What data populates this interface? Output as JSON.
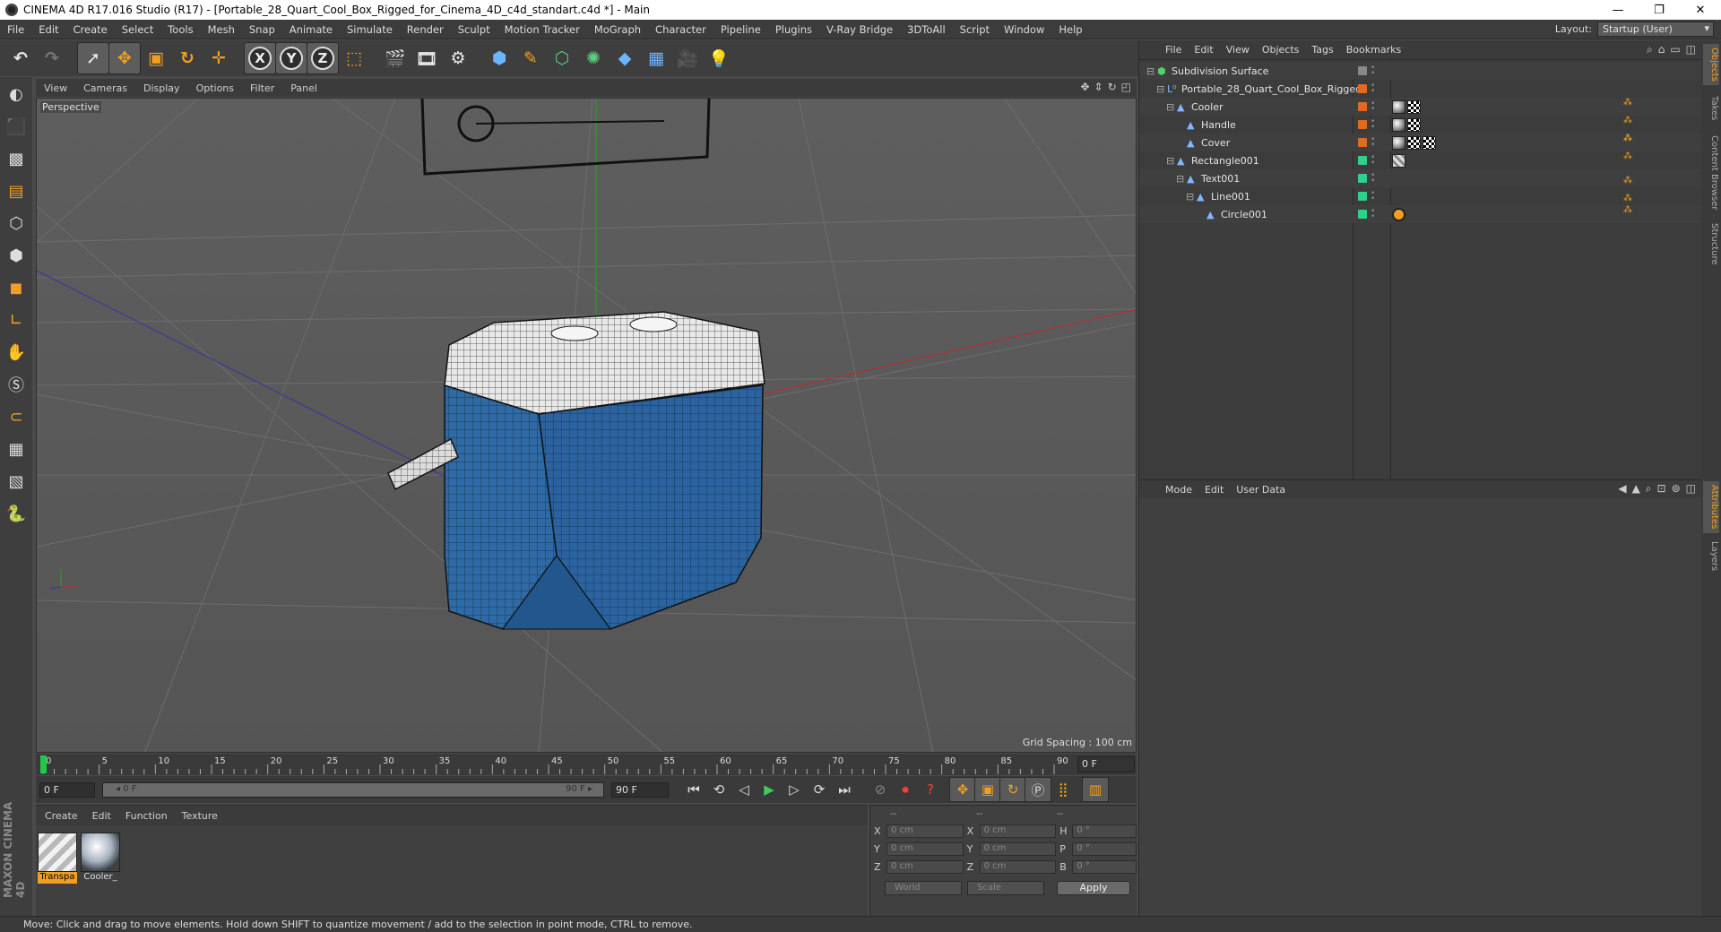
{
  "window": {
    "title": "CINEMA 4D R17.016 Studio (R17) - [Portable_28_Quart_Cool_Box_Rigged_for_Cinema_4D_c4d_standart.c4d *] - Main",
    "minimize": "—",
    "maximize": "❐",
    "close": "✕"
  },
  "menubar": {
    "items": [
      "File",
      "Edit",
      "Create",
      "Select",
      "Tools",
      "Mesh",
      "Snap",
      "Animate",
      "Simulate",
      "Render",
      "Sculpt",
      "Motion Tracker",
      "MoGraph",
      "Character",
      "Pipeline",
      "Plugins",
      "V-Ray Bridge",
      "3DToAll",
      "Script",
      "Window",
      "Help"
    ],
    "layout_label": "Layout:",
    "layout_value": "Startup (User)"
  },
  "toolbar": {
    "x_label": "X",
    "y_label": "Y",
    "z_label": "Z"
  },
  "viewport": {
    "menu": [
      "View",
      "Cameras",
      "Display",
      "Options",
      "Filter",
      "Panel"
    ],
    "label": "Perspective",
    "grid_spacing": "Grid Spacing : 100 cm"
  },
  "timeline": {
    "ticks": [
      "0",
      "5",
      "10",
      "15",
      "20",
      "25",
      "30",
      "35",
      "40",
      "45",
      "50",
      "55",
      "60",
      "65",
      "70",
      "75",
      "80",
      "85",
      "90"
    ],
    "end_field": "0 F",
    "current_frame": "0 F",
    "range_start": "◂ 0 F",
    "range_end": "90 F ▸",
    "max_frame": "90 F"
  },
  "material_manager": {
    "menu": [
      "Create",
      "Edit",
      "Function",
      "Texture"
    ],
    "materials": [
      {
        "name": "Transpa",
        "selected": true
      },
      {
        "name": "Cooler_",
        "selected": false
      }
    ]
  },
  "coordinates": {
    "headers": [
      "--",
      "--",
      "--"
    ],
    "rows": [
      {
        "a": "X",
        "v1": "0 cm",
        "b": "X",
        "v2": "0 cm",
        "c": "H",
        "v3": "0 °"
      },
      {
        "a": "Y",
        "v1": "0 cm",
        "b": "Y",
        "v2": "0 cm",
        "c": "P",
        "v3": "0 °"
      },
      {
        "a": "Z",
        "v1": "0 cm",
        "b": "Z",
        "v2": "0 cm",
        "c": "B",
        "v3": "0 °"
      }
    ],
    "mode_world": "World",
    "mode_scale": "Scale",
    "apply": "Apply"
  },
  "object_manager": {
    "menu": [
      "File",
      "Edit",
      "View",
      "Objects",
      "Tags",
      "Bookmarks"
    ],
    "objects": [
      {
        "name": "Subdivision Surface",
        "indent": 0,
        "icon": "subdivision-icon",
        "color": "#888888",
        "tags": []
      },
      {
        "name": "Portable_28_Quart_Cool_Box_Rigged",
        "indent": 1,
        "icon": "null-icon",
        "color": "#e06a20",
        "tags": []
      },
      {
        "name": "Cooler",
        "indent": 2,
        "icon": "polygon-icon",
        "color": "#e06a20",
        "tags": [
          "sphere",
          "check",
          "dots"
        ]
      },
      {
        "name": "Handle",
        "indent": 3,
        "icon": "polygon-icon",
        "color": "#e06a20",
        "tags": [
          "sphere",
          "check",
          "dots"
        ]
      },
      {
        "name": "Cover",
        "indent": 3,
        "icon": "polygon-icon",
        "color": "#e06a20",
        "tags": [
          "dots",
          "sphere",
          "check",
          "check",
          "dots"
        ]
      },
      {
        "name": "Rectangle001",
        "indent": 2,
        "icon": "spline-icon",
        "color": "#2fd08a",
        "tags": [
          "dots",
          "stripe"
        ]
      },
      {
        "name": "Text001",
        "indent": 3,
        "icon": "spline-icon",
        "color": "#2fd08a",
        "tags": [
          "dots"
        ]
      },
      {
        "name": "Line001",
        "indent": 4,
        "icon": "spline-icon",
        "color": "#2fd08a",
        "tags": [
          "dots"
        ]
      },
      {
        "name": "Circle001",
        "indent": 5,
        "icon": "spline-icon",
        "color": "#2fd08a",
        "tags": [
          "noentry",
          "dots"
        ]
      }
    ]
  },
  "attribute_manager": {
    "menu": [
      "Mode",
      "Edit",
      "User Data"
    ]
  },
  "side_tabs": [
    "Objects",
    "Takes",
    "Content Browser",
    "Structure",
    "Attributes",
    "Layers"
  ],
  "status": {
    "text": "Move: Click and drag to move elements. Hold down SHIFT to quantize movement / add to the selection in point mode, CTRL to remove."
  },
  "branding": {
    "maxon": "MAXON",
    "cinema": "CINEMA 4D"
  },
  "colors": {
    "accent": "#f0a020",
    "cooler_blue": "#2e6aa8"
  }
}
